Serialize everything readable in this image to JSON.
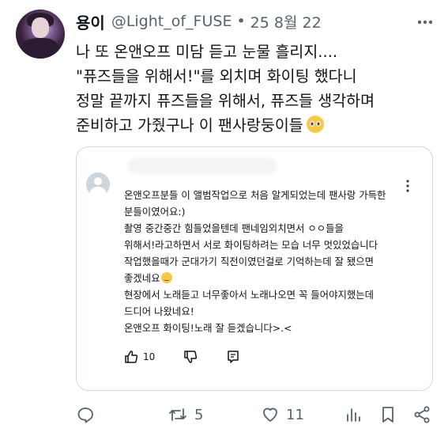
{
  "tweet": {
    "author_name": "용이",
    "handle": "@Light_of_FUSE",
    "separator": "•",
    "date": "25 8월 22",
    "lines": [
      "나 또 온앤오프 미담 듣고 눈물 흘리지....",
      "\"퓨즈들을 위해서!\"를 외치며 화이팅 했다니",
      "정말 끝까지 퓨즈들을 위해서, 퓨즈들 생각하며",
      "준비하고 가줬구나 이 팬사랑둥이들"
    ],
    "emoji": "pleading-face"
  },
  "quoted_comment": {
    "lines": [
      "온앤오프분들 이 앨범작업으로 처음 알게되었는데 팬사랑 가득한",
      "분들이였어요:)",
      "촬영 중간중간 힘들었을텐데 팬네임외치면서 ㅇㅇ들을",
      "위해서!라고하면서 서로 화이팅하려는 모습 너무 멋있었습니다",
      "작업했을때가 군대가기 직전이였던걸로 기억하는데 잘 됐으면",
      "좋겠네요",
      "현장에서 노래듣고 너무좋아서 노래나오면 꼭 들어야지했는데",
      "드디어 나왔네요!",
      "온앤오프 화이팅!노래 잘 듣겠습니다>.<"
    ],
    "emoji": "smiling-face",
    "like_count": "10"
  },
  "actions": {
    "retweet_count": "5",
    "like_count": "11"
  },
  "colors": {
    "text": "#0f1419",
    "secondary": "#536471",
    "border": "#cfd9de"
  }
}
